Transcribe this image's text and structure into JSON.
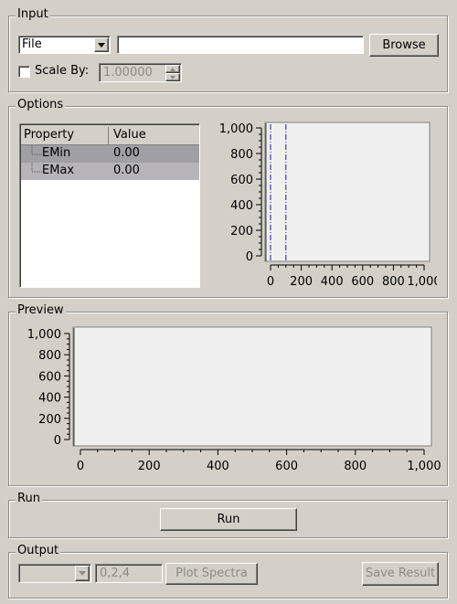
{
  "input": {
    "title": "Input",
    "type_select": "File",
    "file_path": "",
    "browse_label": "Browse",
    "scale_label": "Scale By:",
    "scale_checked": false,
    "scale_value": "1.00000"
  },
  "options": {
    "title": "Options",
    "table": {
      "columns": [
        "Property",
        "Value"
      ],
      "rows": [
        {
          "property": "EMin",
          "value": "0.00"
        },
        {
          "property": "EMax",
          "value": "0.00"
        }
      ]
    },
    "plot": {
      "y_ticks": [
        "1,000",
        "800",
        "600",
        "400",
        "200",
        "0"
      ],
      "x_ticks": [
        "0",
        "200",
        "400",
        "600",
        "800",
        "1,000"
      ],
      "range_lines_color": "#1a1aa6"
    }
  },
  "preview": {
    "title": "Preview",
    "plot": {
      "y_ticks": [
        "1,000",
        "800",
        "600",
        "400",
        "200",
        "0"
      ],
      "x_ticks": [
        "0",
        "200",
        "400",
        "600",
        "800",
        "1,000"
      ]
    }
  },
  "run": {
    "title": "Run",
    "run_label": "Run"
  },
  "output": {
    "title": "Output",
    "workspace_select": "",
    "spectra_value": "0,2,4",
    "plot_label": "Plot Spectra",
    "save_label": "Save Result"
  },
  "chart_data": [
    {
      "type": "line",
      "xlim": [
        0,
        1000
      ],
      "ylim": [
        0,
        1000
      ],
      "x_tick_labels": [
        "0",
        "200",
        "400",
        "600",
        "800",
        "1,000"
      ],
      "y_tick_labels": [
        "0",
        "200",
        "400",
        "600",
        "800",
        "1,000"
      ],
      "series": [],
      "range_markers_x": [
        0,
        100
      ],
      "grid": false
    },
    {
      "type": "line",
      "xlim": [
        0,
        1000
      ],
      "ylim": [
        0,
        1000
      ],
      "x_tick_labels": [
        "0",
        "200",
        "400",
        "600",
        "800",
        "1,000"
      ],
      "y_tick_labels": [
        "0",
        "200",
        "400",
        "600",
        "800",
        "1,000"
      ],
      "series": [],
      "grid": false
    }
  ]
}
